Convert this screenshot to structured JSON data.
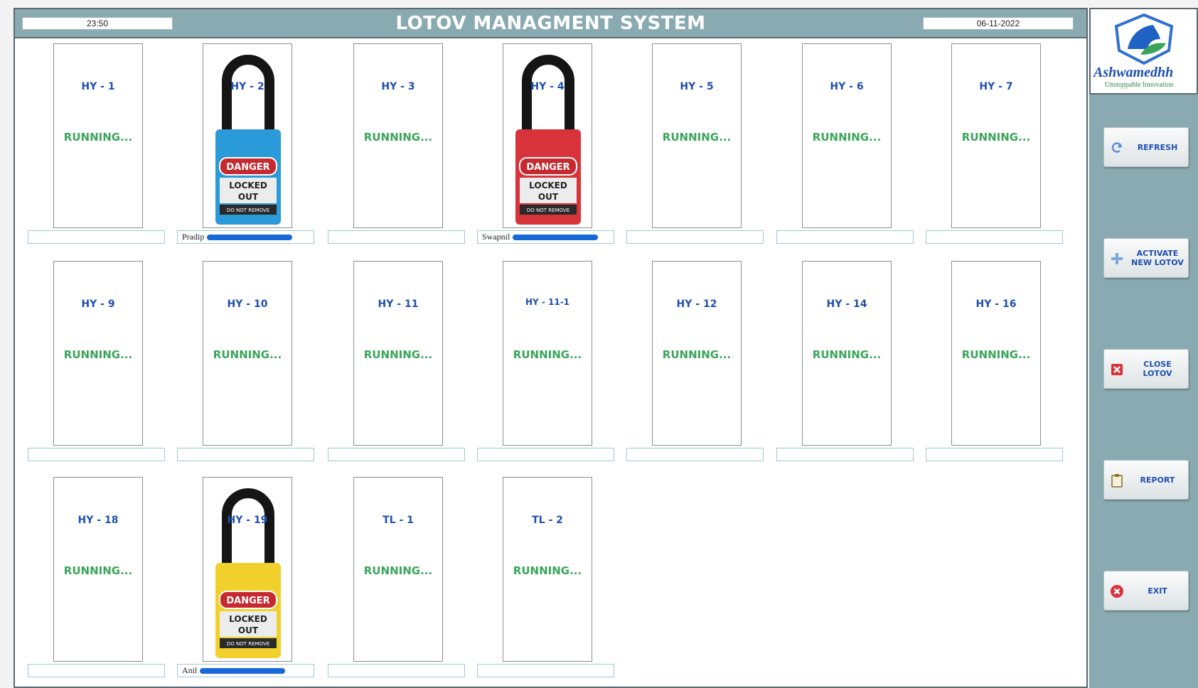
{
  "header": {
    "title": "LOTOV MANAGMENT SYSTEM",
    "time": "23:50",
    "date": "06-11-2022"
  },
  "status_text": "RUNNING...",
  "cards": [
    {
      "label": "HY - 1",
      "locked": false
    },
    {
      "label": "HY - 2",
      "locked": true,
      "lock_color": "#2a9ad8",
      "caption": "Pradip"
    },
    {
      "label": "HY - 3",
      "locked": false
    },
    {
      "label": "HY - 4",
      "locked": true,
      "lock_color": "#d8333a",
      "caption": "Swapnil"
    },
    {
      "label": "HY - 5",
      "locked": false
    },
    {
      "label": "HY - 6",
      "locked": false
    },
    {
      "label": "HY - 7",
      "locked": false
    },
    {
      "label": "HY - 9",
      "locked": false
    },
    {
      "label": "HY - 10",
      "locked": false
    },
    {
      "label": "HY - 11",
      "locked": false
    },
    {
      "label": "HY - 11-1",
      "locked": false
    },
    {
      "label": "HY - 12",
      "locked": false
    },
    {
      "label": "HY - 14",
      "locked": false
    },
    {
      "label": "HY - 16",
      "locked": false
    },
    {
      "label": "HY - 18",
      "locked": false
    },
    {
      "label": "HY - 19",
      "locked": true,
      "lock_color": "#f2d02c",
      "caption": "Anil"
    },
    {
      "label": "TL - 1",
      "locked": false
    },
    {
      "label": "TL - 2",
      "locked": false
    }
  ],
  "padlock": {
    "danger": "DANGER",
    "locked_line1": "LOCKED",
    "locked_line2": "OUT",
    "note": "DO NOT REMOVE"
  },
  "logo": {
    "name": "Ashwamedhh",
    "tagline": "Unstoppable Innovation"
  },
  "sidebar": {
    "buttons": [
      {
        "id": "refresh",
        "label": "REFRESH",
        "icon": "refresh-icon"
      },
      {
        "id": "activate",
        "label": "ACTIVATE NEW LOTOV",
        "icon": "plus-icon"
      },
      {
        "id": "close",
        "label": "CLOSE LOTOV",
        "icon": "close-icon"
      },
      {
        "id": "report",
        "label": "REPORT",
        "icon": "clipboard-icon"
      },
      {
        "id": "exit",
        "label": "EXIT",
        "icon": "exit-icon"
      }
    ]
  },
  "colors": {
    "accent": "#8aaab1",
    "label_blue": "#1f4fae",
    "status_green": "#3aa55a"
  }
}
